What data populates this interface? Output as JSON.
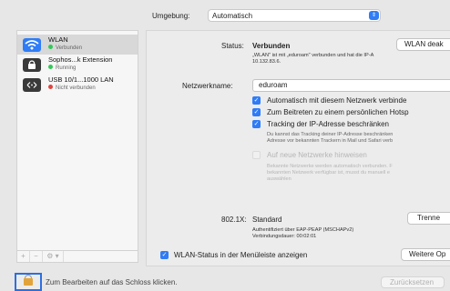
{
  "location": {
    "label": "Umgebung:",
    "value": "Automatisch"
  },
  "sidebar": {
    "items": [
      {
        "name": "WLAN",
        "status": "Verbunden",
        "status_color": "#34c759",
        "icon": "wifi-icon",
        "icon_bg": "#2f7cf6"
      },
      {
        "name": "Sophos...k Extension",
        "status": "Running",
        "status_color": "#34c759",
        "icon": "lock-icon",
        "icon_bg": "#3a3a3a"
      },
      {
        "name": "USB 10/1...1000 LAN",
        "status": "Nicht verbunden",
        "status_color": "#e0443e",
        "icon": "ethernet-icon",
        "icon_bg": "#3a3a3a"
      }
    ],
    "tools": [
      "+",
      "−",
      "⚙ ▾"
    ]
  },
  "panel": {
    "status_label": "Status:",
    "status_value": "Verbunden",
    "disable_button": "WLAN deak",
    "status_info_line1": "„WLAN\" ist mit „eduroam\" verbunden und hat die IP-A",
    "status_info_line2": "10.132.83.6.",
    "network_label": "Netzwerkname:",
    "network_value": "eduroam",
    "options": [
      {
        "label": "Automatisch mit diesem Netzwerk verbinde",
        "checked": true,
        "enabled": true
      },
      {
        "label": "Zum Beitreten zu einem persönlichen Hotsp",
        "checked": true,
        "enabled": true
      },
      {
        "label": "Tracking der IP-Adresse beschränken",
        "checked": true,
        "enabled": true
      }
    ],
    "tracking_note_line1": "Du kannst das Tracking deiner IP-Adresse beschränken",
    "tracking_note_line2": "Adresse vor bekannten Trackern in Mail und Safari verb",
    "ask_new_label": "Auf neue Netzwerke hinweisen",
    "ask_new_note_line1": "Bekannte Netzwerke werden automatisch verbunden. F",
    "ask_new_note_line2": "bekannten Netzwerk verfügbar ist, musst du manuell e",
    "ask_new_note_line3": "auswählen",
    "auth_label": "802.1X:",
    "auth_value": "Standard",
    "disconnect_button": "Trenne",
    "auth_info_line1": "Authentifiziert über EAP-PEAP (MSCHAPv2)",
    "auth_info_line2": "Verbindungsdauer: 00:02:01",
    "menubar_label": "WLAN-Status in der Menüleiste anzeigen",
    "advanced_button": "Weitere Op"
  },
  "footer": {
    "lock_text": "Zum Bearbeiten auf das Schloss klicken.",
    "reset_button": "Zurücksetzen"
  }
}
